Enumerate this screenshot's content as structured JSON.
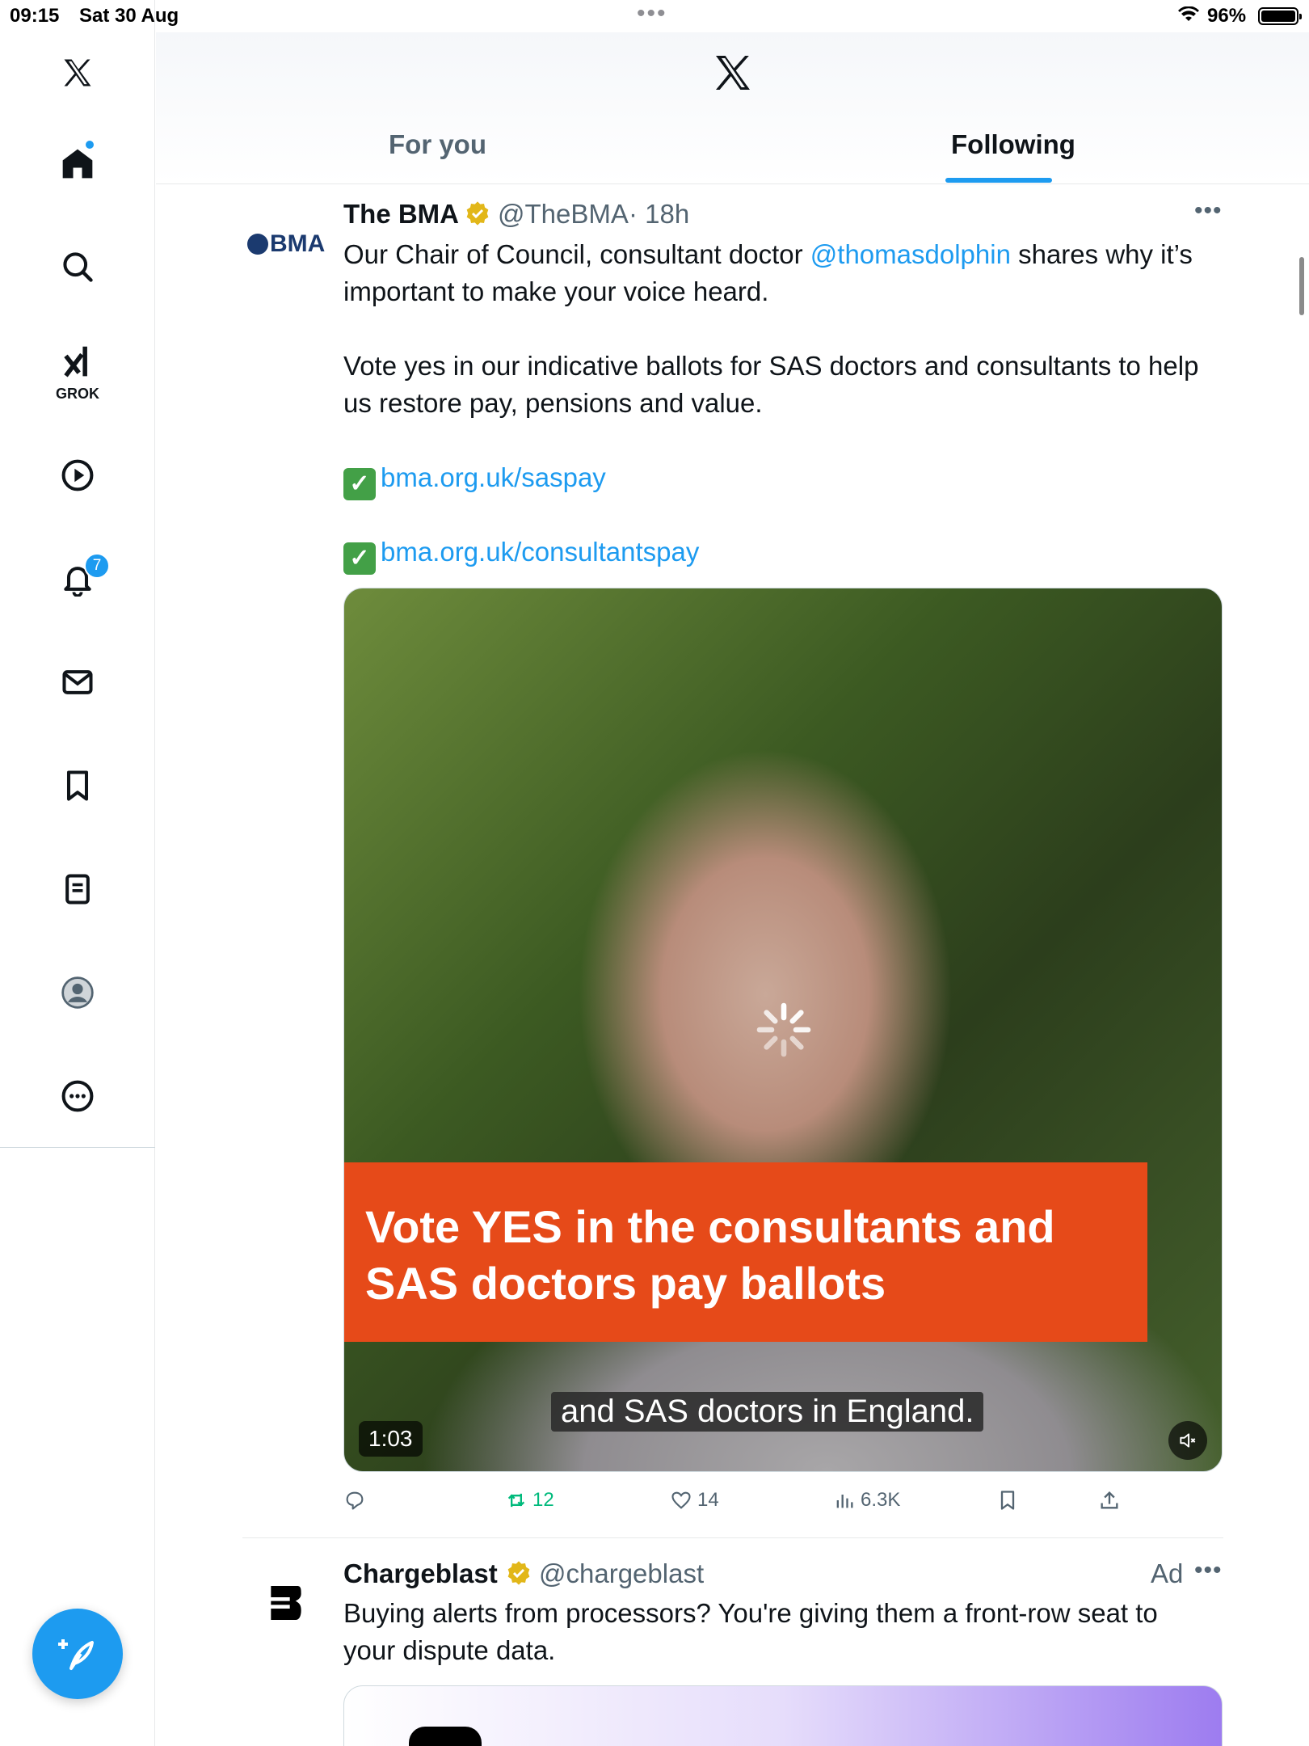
{
  "status_bar": {
    "time": "09:15",
    "date": "Sat 30 Aug",
    "battery": "96%"
  },
  "nav": {
    "notifications_badge": "7",
    "grok_label": "GROK"
  },
  "header": {
    "tabs": [
      {
        "label": "For you"
      },
      {
        "label": "Following"
      }
    ]
  },
  "tweet1": {
    "name": "The BMA",
    "handle": "@TheBMA",
    "time": "· 18h",
    "avatar_text": "BMA",
    "body_line1_pre": "Our Chair of Council, consultant doctor ",
    "mention": "@thomasdolphin",
    "body_line1_post": " shares why it’s important to make your voice heard.",
    "body_para2": "Vote yes in our indicative ballots for SAS doctors and consultants to help us restore pay, pensions and value.",
    "check1": "✓",
    "link1": "bma.org.uk/saspay",
    "check2": "✓",
    "link2": "bma.org.uk/consultantspay",
    "video": {
      "banner_line1": "Vote YES in the consultants and",
      "banner_line2": "SAS doctors pay ballots",
      "caption": "and SAS doctors in England.",
      "duration": "1:03"
    },
    "stats": {
      "retweets": "12",
      "likes": "14",
      "views": "6.3K"
    }
  },
  "tweet2": {
    "name": "Chargeblast",
    "handle": "@chargeblast",
    "ad_label": "Ad",
    "body": "Buying alerts from processors? You're giving them a front-row seat to your dispute data."
  },
  "colors": {
    "accent": "#1d9bf0",
    "retweet": "#00ba7c",
    "banner": "#e64a19",
    "verified": "#e2b719"
  }
}
